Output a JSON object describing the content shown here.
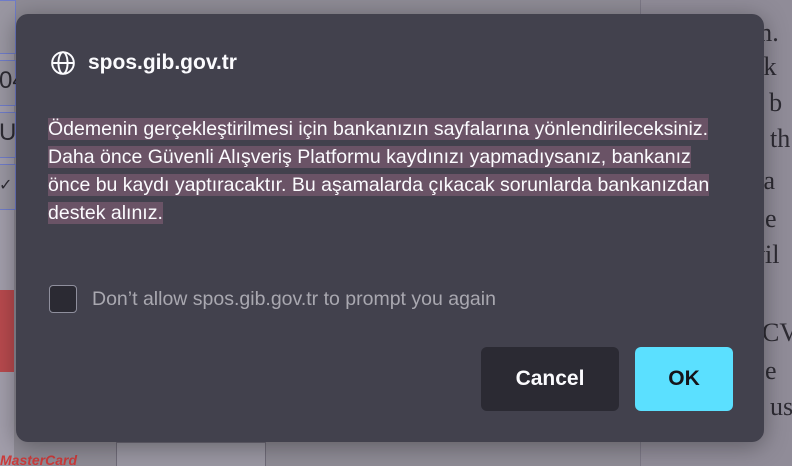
{
  "dialog": {
    "origin": "spos.gib.gov.tr",
    "message_line1": "Ödemenin gerçekleştirilmesi için bankanızın sayfalarına yönlendirileceksiniz.",
    "message_line2": "Daha önce Güvenli Alışveriş Platformu kaydınızı yapmadıysanız, bankanız önce bu kaydı yaptıracaktır. Bu aşamalarda çıkacak sorunlarda bankanızdan destek alınız.",
    "checkbox_label": "Don’t allow spos.gib.gov.tr to prompt you again",
    "checkbox_checked": false,
    "cancel_label": "Cancel",
    "ok_label": "OK",
    "icon": "globe-icon",
    "accent_color": "#5be0ff"
  },
  "background": {
    "right_text": [
      "m.",
      "ak",
      "\" b",
      "th",
      "ca",
      "pe",
      "vil",
      "CV",
      "pe",
      "us"
    ],
    "left_text": [
      "04",
      "U",
      "✓"
    ],
    "card_text": "MasterCard"
  }
}
